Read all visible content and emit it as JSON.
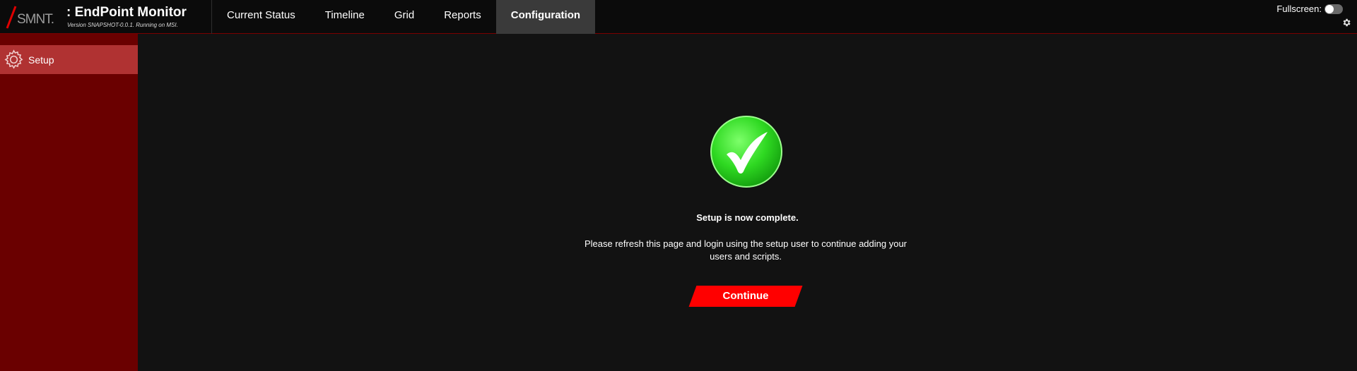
{
  "header": {
    "logo_text": "SMNT.",
    "title": ": EndPoint Monitor",
    "version": "Version SNAPSHOT-0.0.1. Running on MSI.",
    "fullscreen_label": "Fullscreen:",
    "fullscreen_on": false
  },
  "nav": {
    "tabs": [
      {
        "label": "Current Status"
      },
      {
        "label": "Timeline"
      },
      {
        "label": "Grid"
      },
      {
        "label": "Reports"
      },
      {
        "label": "Configuration",
        "active": true
      }
    ]
  },
  "sidebar": {
    "items": [
      {
        "label": "Setup",
        "icon": "gear-icon",
        "active": true
      }
    ]
  },
  "main": {
    "status_icon": "check-icon",
    "title": "Setup is now complete.",
    "message": "Please refresh this page and login using the setup user to continue adding your users and scripts.",
    "continue_label": "Continue"
  },
  "colors": {
    "accent_red": "#ff0000",
    "sidebar_bg": "#6a0000",
    "sidebar_active": "#b03232",
    "success_green": "#22c71c"
  }
}
